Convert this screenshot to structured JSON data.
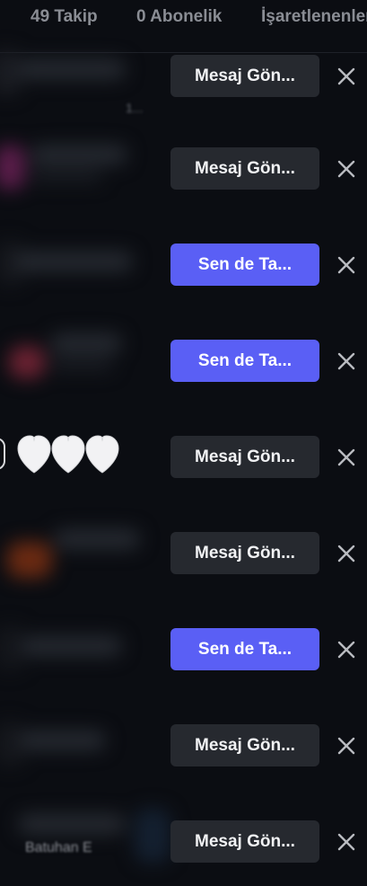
{
  "tabs": [
    {
      "label": "49 Takip"
    },
    {
      "label": "0 Abonelik"
    },
    {
      "label": "İşaretlenenler"
    }
  ],
  "rows": [
    {
      "action_label": "Mesaj Gön...",
      "style": "secondary"
    },
    {
      "action_label": "Mesaj Gön...",
      "style": "secondary"
    },
    {
      "action_label": "Sen de Ta...",
      "style": "primary"
    },
    {
      "action_label": "Sen de Ta...",
      "style": "primary"
    },
    {
      "action_label": "Mesaj Gön...",
      "style": "secondary"
    },
    {
      "action_label": "Mesaj Gön...",
      "style": "secondary"
    },
    {
      "action_label": "Sen de Ta...",
      "style": "primary"
    },
    {
      "action_label": "Mesaj Gön...",
      "style": "secondary"
    },
    {
      "action_label": "Mesaj Gön...",
      "style": "secondary"
    }
  ],
  "visible_text": {
    "partial_username": "Batuhan E",
    "row1_sub_fragment": "1..."
  },
  "icons": {
    "hearts": "white-heart-emoji x3",
    "remove": "close-icon"
  },
  "colors": {
    "background": "#0b0d12",
    "primary_button": "#5a5ff5",
    "secondary_button": "#26292f"
  }
}
